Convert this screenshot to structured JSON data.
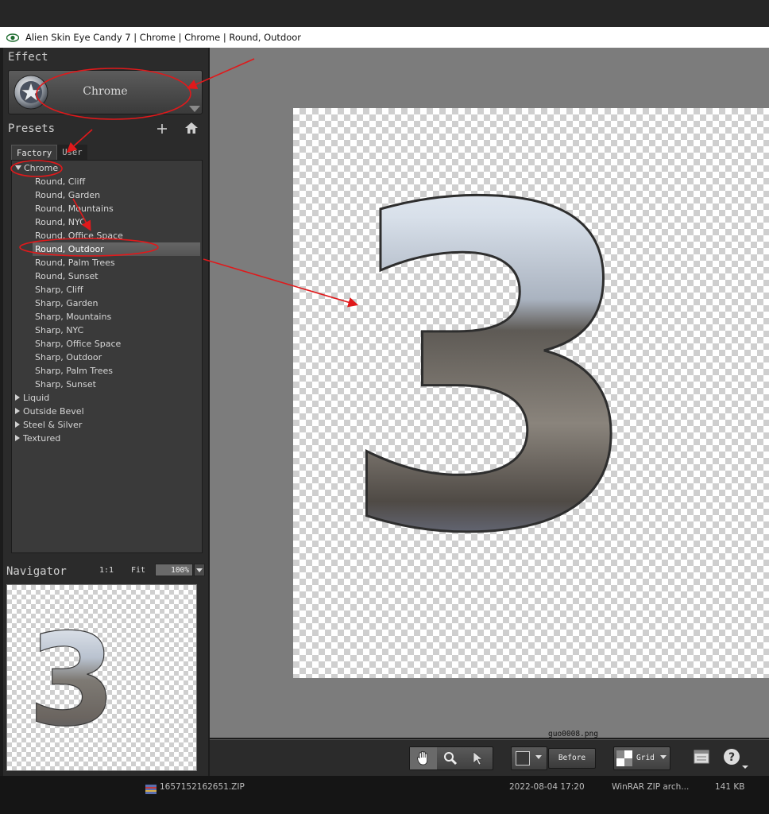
{
  "window": {
    "title": "Alien Skin Eye Candy 7 | Chrome | Chrome | Round, Outdoor"
  },
  "effect": {
    "heading": "Effect",
    "name": "Chrome"
  },
  "presets": {
    "heading": "Presets",
    "tabs": [
      "Factory",
      "User"
    ],
    "tree": [
      {
        "label": "Chrome",
        "expanded": true,
        "level": 0
      },
      {
        "label": "Round, Cliff",
        "level": 1
      },
      {
        "label": "Round, Garden",
        "level": 1
      },
      {
        "label": "Round, Mountains",
        "level": 1
      },
      {
        "label": "Round, NYC",
        "level": 1
      },
      {
        "label": "Round, Office Space",
        "level": 1
      },
      {
        "label": "Round, Outdoor",
        "level": 1,
        "selected": true
      },
      {
        "label": "Round, Palm Trees",
        "level": 1
      },
      {
        "label": "Round, Sunset",
        "level": 1
      },
      {
        "label": "Sharp, Cliff",
        "level": 1
      },
      {
        "label": "Sharp, Garden",
        "level": 1
      },
      {
        "label": "Sharp, Mountains",
        "level": 1
      },
      {
        "label": "Sharp, NYC",
        "level": 1
      },
      {
        "label": "Sharp, Office Space",
        "level": 1
      },
      {
        "label": "Sharp, Outdoor",
        "level": 1
      },
      {
        "label": "Sharp, Palm Trees",
        "level": 1
      },
      {
        "label": "Sharp, Sunset",
        "level": 1
      },
      {
        "label": "Liquid",
        "expanded": false,
        "level": 0
      },
      {
        "label": "Outside Bevel",
        "expanded": false,
        "level": 0
      },
      {
        "label": "Steel & Silver",
        "expanded": false,
        "level": 0
      },
      {
        "label": "Textured",
        "expanded": false,
        "level": 0
      }
    ]
  },
  "navigator": {
    "heading": "Navigator",
    "one_to_one": "1:1",
    "fit": "Fit",
    "zoom": "100%"
  },
  "preview": {
    "filename": "guo0008.png",
    "glyph": "3"
  },
  "toolbar": {
    "tools": [
      "hand-tool-icon",
      "zoom-tool-icon",
      "pointer-tool-icon"
    ],
    "before_label": "Before",
    "grid_label": "Grid"
  },
  "taskbar": {
    "file_name": "1657152162651.ZIP",
    "date": "2022-08-04 17:20",
    "type": "WinRAR ZIP arch...",
    "size": "141 KB"
  },
  "colors": {
    "annotation_red": "#e0191b",
    "panel": "#2b2b2b",
    "canvas_bg": "#7c7c7c"
  }
}
